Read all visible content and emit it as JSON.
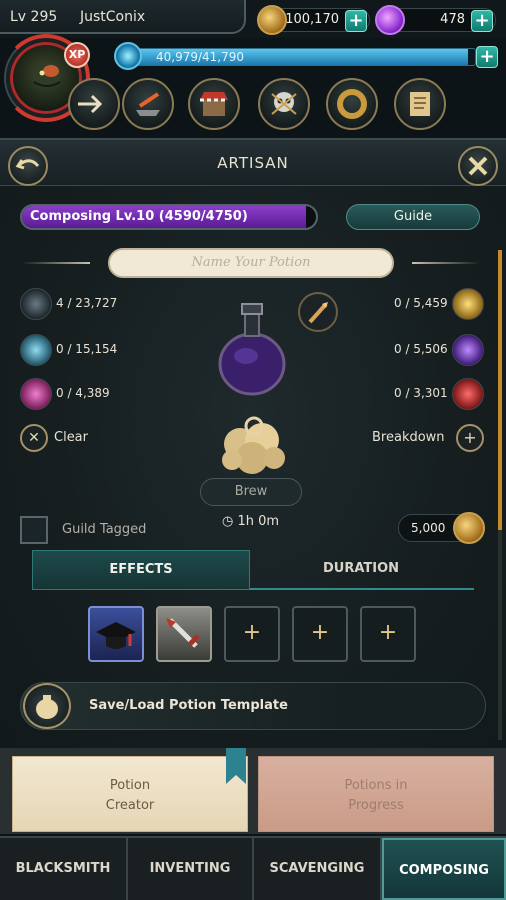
{
  "player": {
    "level": "Lv 295",
    "name": "JustConix",
    "xp_badge": "XP"
  },
  "currencies": {
    "gold": "100,170",
    "gems": "478"
  },
  "xp": {
    "text": "40,979/41,790",
    "fraction": 0.9806
  },
  "panel": {
    "title": "ARTISAN",
    "composing_level": "Composing Lv.10 (4590/4750)",
    "composing_fraction": 0.9663,
    "guide_label": "Guide",
    "name_placeholder": "Name Your Potion",
    "ingredients_left": [
      "4 / 23,727",
      "0 / 15,154",
      "0 / 4,389"
    ],
    "ingredients_right": [
      "0 / 5,459",
      "0 / 5,506",
      "0 / 3,301"
    ],
    "clear_label": "Clear",
    "breakdown_label": "Breakdown",
    "brew_label": "Brew",
    "brew_time": "1h 0m",
    "guild_tagged_label": "Guild Tagged",
    "cost": "5,000",
    "tabs": [
      "EFFECTS",
      "DURATION"
    ],
    "slot_add_symbol": "+",
    "template_label": "Save/Load Potion Template"
  },
  "cards": {
    "creator": [
      "Potion",
      "Creator"
    ],
    "progress": [
      "Potions in",
      "Progress"
    ]
  },
  "nav": [
    "BLACKSMITH",
    "INVENTING",
    "SCAVENGING",
    "COMPOSING"
  ],
  "icons": {
    "gold": "gold-coin-icon",
    "gem": "purple-gem-icon",
    "ingredients_left": [
      "dark-ore-icon",
      "blue-crystal-icon",
      "pink-crystal-icon"
    ],
    "ingredients_right": [
      "gold-crystal-icon",
      "purple-crystal-icon",
      "red-crystal-icon"
    ]
  }
}
